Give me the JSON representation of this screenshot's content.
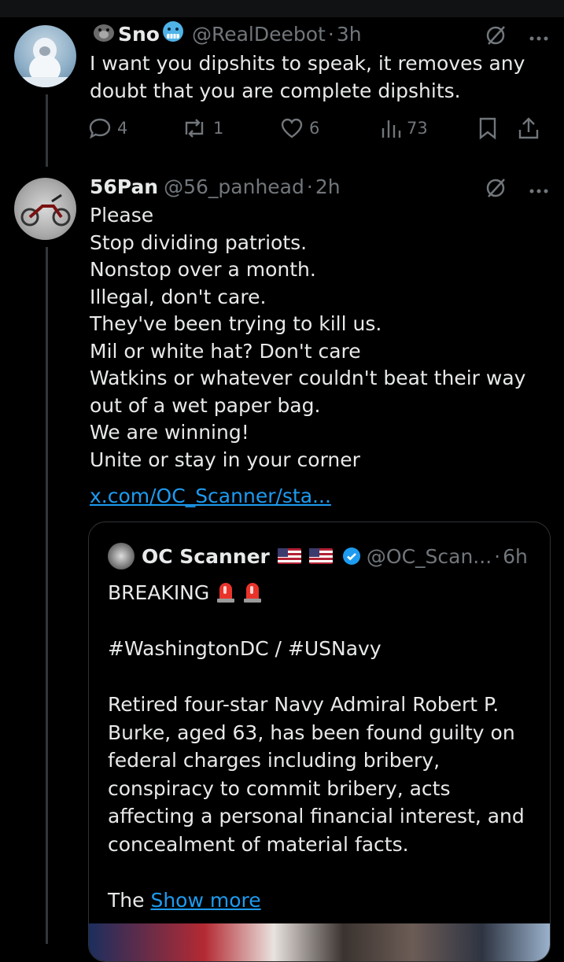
{
  "tweet1": {
    "name": "Sno",
    "handle": "@RealDeebot",
    "time": "3h",
    "text": "I want you dipshits to speak, it removes any doubt that you are complete dipshits.",
    "replies": "4",
    "reposts": "1",
    "likes": "6",
    "views": "73"
  },
  "tweet2": {
    "name": "56Pan",
    "handle": "@56_panhead",
    "time": "2h",
    "text": "Please\nStop dividing patriots.\nNonstop over a month.\nIllegal, don't care.\nThey've been trying to kill us.\nMil or white hat? Don't care\nWatkins or whatever couldn't beat their way out of a wet paper bag.\nWe are winning!\nUnite or stay in your corner",
    "link": "x.com/OC_Scanner/sta..."
  },
  "quote": {
    "name": "OC Scanner",
    "handle": "@OC_Scan...",
    "time": "6h",
    "line1": "BREAKING",
    "line2": "#WashingtonDC / #USNavy",
    "body": "Retired four-star Navy Admiral Robert P. Burke, aged 63, has been found guilty on federal charges including bribery, conspiracy to commit bribery, acts affecting a personal financial interest, and concealment of material facts.",
    "tail": "The",
    "show_more": "Show more"
  },
  "colors": {
    "background": "#000000",
    "text": "#e7e9ea",
    "muted": "#71767b",
    "link": "#1d9bf0",
    "border": "#2f3336",
    "verified": "#1d9bf0"
  },
  "icons": {
    "grok": "grok-icon",
    "more": "more-icon",
    "reply": "reply-icon",
    "repost": "repost-icon",
    "like": "heart-icon",
    "views": "views-icon",
    "bookmark": "bookmark-icon",
    "share": "share-icon",
    "emoji_gorilla": "gorilla-emoji-icon",
    "emoji_cold": "cold-face-emoji-icon",
    "siren": "siren-emoji-icon",
    "flag": "us-flag-icon",
    "verified": "verified-badge-icon"
  }
}
